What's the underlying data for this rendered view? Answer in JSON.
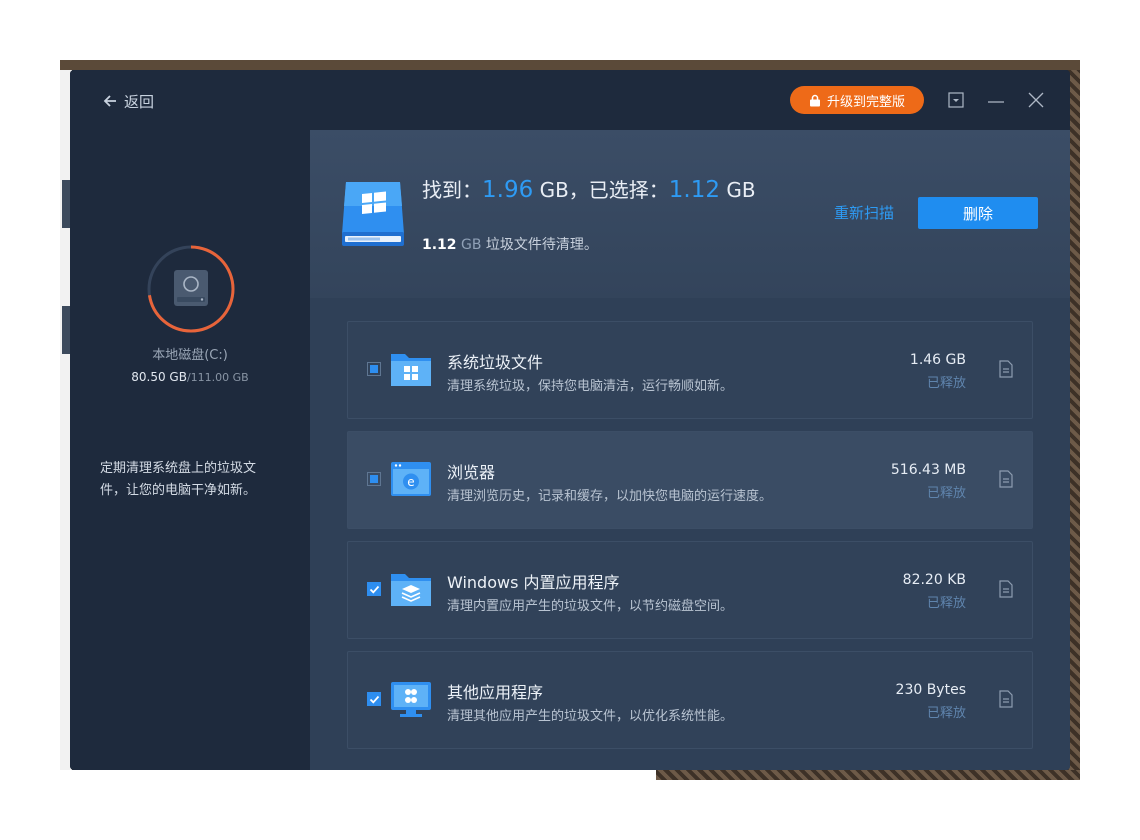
{
  "titlebar": {
    "back_label": "返回",
    "upgrade_label": "升级到完整版"
  },
  "sidebar": {
    "disk_name": "本地磁盘(C:)",
    "disk_used": "80.50 GB",
    "disk_total": "/111.00 GB",
    "disk_used_fraction": 0.725,
    "tip": "定期清理系统盘上的垃圾文件，让您的电脑干净如新。"
  },
  "summary": {
    "found_label": "找到：",
    "found_value": "1.96",
    "found_unit": "GB，",
    "selected_label": "已选择：",
    "selected_value": "1.12",
    "selected_unit": "GB",
    "pending_value": "1.12",
    "pending_unit": "GB",
    "pending_text": "垃圾文件待清理。",
    "rescan_label": "重新扫描",
    "delete_label": "删除"
  },
  "items": [
    {
      "title": "系统垃圾文件",
      "desc": "清理系统垃圾，保持您电脑清洁，运行畅顺如新。",
      "size": "1.46 GB",
      "status": "已释放",
      "check": "partial",
      "icon": "windows-folder-icon"
    },
    {
      "title": "浏览器",
      "desc": "清理浏览历史，记录和缓存，以加快您电脑的运行速度。",
      "size": "516.43 MB",
      "status": "已释放",
      "check": "partial",
      "icon": "browser-icon"
    },
    {
      "title": "Windows 内置应用程序",
      "desc": "清理内置应用产生的垃圾文件，以节约磁盘空间。",
      "size": "82.20 KB",
      "status": "已释放",
      "check": "checked",
      "icon": "layers-folder-icon"
    },
    {
      "title": "其他应用程序",
      "desc": "清理其他应用产生的垃圾文件，以优化系统性能。",
      "size": "230 Bytes",
      "status": "已释放",
      "check": "checked",
      "icon": "monitor-apps-icon"
    }
  ],
  "colors": {
    "accent": "#2e9bf4",
    "upgrade": "#ee6a18",
    "ring": "#e8643a"
  }
}
